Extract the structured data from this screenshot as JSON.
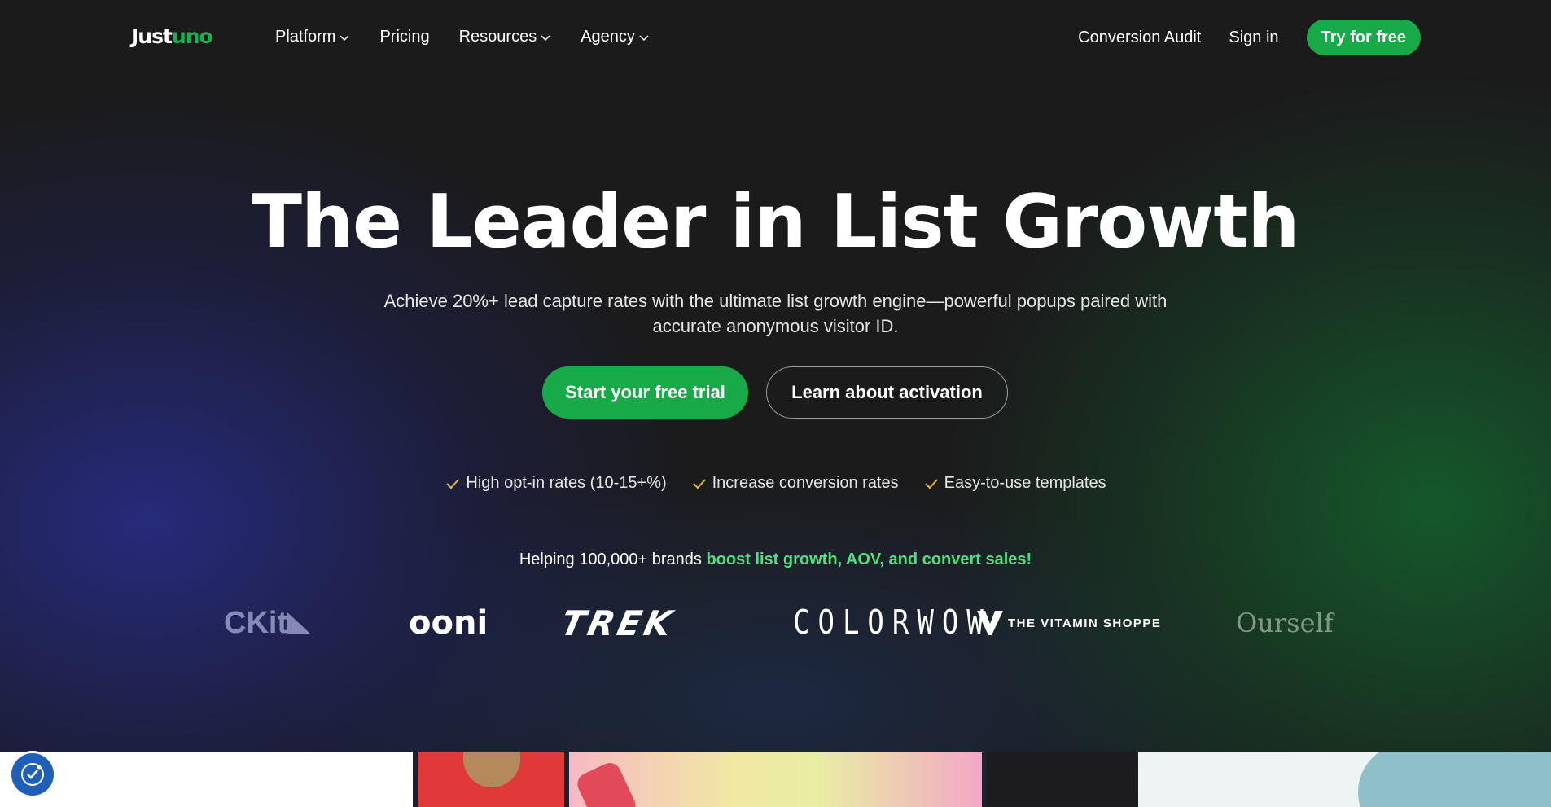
{
  "header": {
    "logo": {
      "part1": "Just",
      "part2": "uno"
    },
    "nav": [
      {
        "label": "Platform",
        "has_dropdown": true
      },
      {
        "label": "Pricing",
        "has_dropdown": false
      },
      {
        "label": "Resources",
        "has_dropdown": true
      },
      {
        "label": "Agency",
        "has_dropdown": true
      }
    ],
    "conversion_audit": "Conversion Audit",
    "sign_in": "Sign in",
    "try_free": "Try for free"
  },
  "hero": {
    "title": "The Leader in List Growth",
    "subtitle": "Achieve 20%+ lead capture rates with the ultimate list growth engine—powerful popups paired with accurate anonymous visitor ID.",
    "cta_primary": "Start your free trial",
    "cta_secondary": "Learn about activation",
    "checks": [
      "High opt-in rates (10-15+%)",
      "Increase conversion rates",
      "Easy-to-use templates"
    ],
    "helping_prefix": "Helping 100,000+ brands ",
    "helping_highlight": "boost list growth, AOV, and convert sales!"
  },
  "brands": {
    "kit": "CKit",
    "ooni": "ooni",
    "trek": "TREK",
    "colorwow": "COLORWOW",
    "vitamin_shoppe": "THE VITAMIN SHOPPE",
    "ourself": "Ourself"
  },
  "colors": {
    "accent": "#18a948",
    "highlight": "#4ee081",
    "background": "#1b1b1c",
    "check": "#e3b341"
  },
  "icons": {
    "chevron": "chevron-down-icon",
    "check": "check-icon",
    "accessibility": "accessibility-icon"
  }
}
